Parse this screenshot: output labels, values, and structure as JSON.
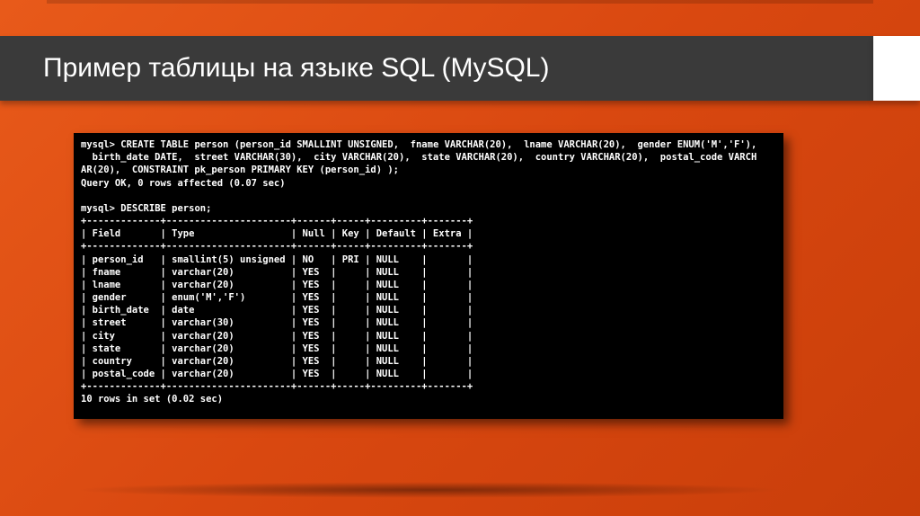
{
  "slide": {
    "title": "Пример таблицы на языке SQL (MySQL)"
  },
  "terminal": {
    "prompt1": "mysql>",
    "create_line1": "CREATE TABLE person (person_id SMALLINT UNSIGNED,  fname VARCHAR(20),  lname VARCHAR(20),  gender ENUM('M','F'),",
    "create_line2": "  birth_date DATE,  street VARCHAR(30),  city VARCHAR(20),  state VARCHAR(20),  country VARCHAR(20),  postal_code VARCH",
    "create_line3": "AR(20),  CONSTRAINT pk_person PRIMARY KEY (person_id) );",
    "query_ok": "Query OK, 0 rows affected (0.07 sec)",
    "blank": "",
    "describe_cmd": "DESCRIBE person;",
    "table_border": "+-------------+----------------------+------+-----+---------+-------+",
    "table_header": "| Field       | Type                 | Null | Key | Default | Extra |",
    "rows": [
      "| person_id   | smallint(5) unsigned | NO   | PRI | NULL    |       |",
      "| fname       | varchar(20)          | YES  |     | NULL    |       |",
      "| lname       | varchar(20)          | YES  |     | NULL    |       |",
      "| gender      | enum('M','F')        | YES  |     | NULL    |       |",
      "| birth_date  | date                 | YES  |     | NULL    |       |",
      "| street      | varchar(30)          | YES  |     | NULL    |       |",
      "| city        | varchar(20)          | YES  |     | NULL    |       |",
      "| state       | varchar(20)          | YES  |     | NULL    |       |",
      "| country     | varchar(20)          | YES  |     | NULL    |       |",
      "| postal_code | varchar(20)          | YES  |     | NULL    |       |"
    ],
    "footer": "10 rows in set (0.02 sec)"
  }
}
